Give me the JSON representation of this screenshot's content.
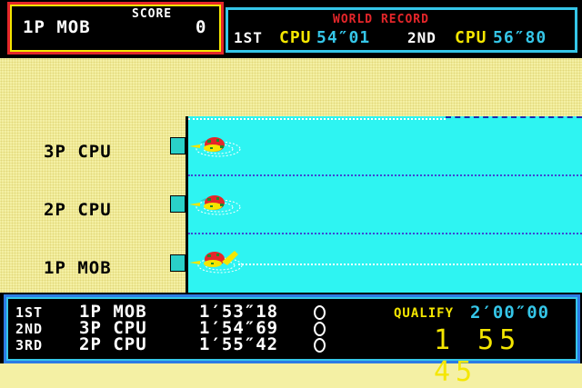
{
  "hud": {
    "player": "1P MOB",
    "score_title": "SCORE",
    "score": "0",
    "world_record": {
      "title": "WORLD RECORD",
      "first_rank": "1ST",
      "first_name": "CPU",
      "first_time": "54″01",
      "second_rank": "2ND",
      "second_name": "CPU",
      "second_time": "56″80"
    }
  },
  "lanes": [
    {
      "label": "3P CPU"
    },
    {
      "label": "2P CPU"
    },
    {
      "label": "1P MOB"
    }
  ],
  "standings": [
    {
      "rank": "1ST",
      "name": "1P MOB",
      "time": "1′53″18"
    },
    {
      "rank": "2ND",
      "name": "3P CPU",
      "time": "1′54″69"
    },
    {
      "rank": "3RD",
      "name": "2P CPU",
      "time": "1′55″42"
    }
  ],
  "qualify": {
    "label": "QUALIFY",
    "time": "2′00″00",
    "current": "1 55 45"
  },
  "colors": {
    "deck": "#f4f0a4",
    "water": "#2ef4f2",
    "red": "#e4262a",
    "yellow": "#f4e600",
    "cyan": "#35c6e8"
  }
}
